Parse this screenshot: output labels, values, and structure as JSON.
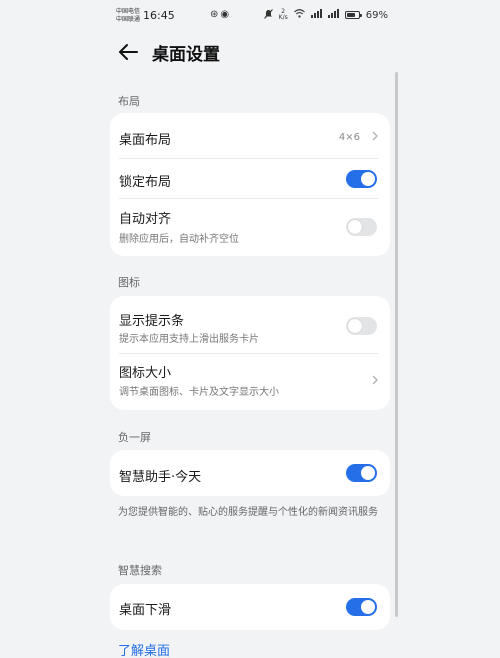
{
  "status_bar": {
    "carrier_1": "中国电信",
    "carrier_2": "中国联通",
    "time": "16:45",
    "net_speed_value": "2",
    "net_speed_unit": "K/s",
    "battery_percent": "69%",
    "battery_level": 0.69
  },
  "header": {
    "title": "桌面设置"
  },
  "sections": {
    "layout": {
      "header": "布局",
      "desktop_layout": {
        "title": "桌面布局",
        "value": "4×6"
      },
      "lock_layout": {
        "title": "锁定布局",
        "enabled": true
      },
      "auto_align": {
        "title": "自动对齐",
        "subtitle": "删除应用后，自动补齐空位",
        "enabled": false
      }
    },
    "icons": {
      "header": "图标",
      "show_badge": {
        "title": "显示提示条",
        "subtitle": "提示本应用支持上滑出服务卡片",
        "enabled": false
      },
      "icon_size": {
        "title": "图标大小",
        "subtitle": "调节桌面图标、卡片及文字显示大小"
      }
    },
    "minus_one": {
      "header": "负一屏",
      "assistant_today": {
        "title": "智慧助手·今天",
        "enabled": true
      },
      "description": "为您提供智能的、贴心的服务提醒与个性化的新闻资讯服务"
    },
    "smart_search": {
      "header": "智慧搜索",
      "swipe_down": {
        "title": "桌面下滑",
        "enabled": true
      }
    }
  },
  "footer_link": "了解桌面",
  "colors": {
    "accent": "#256fe8",
    "background": "#f1f3f5",
    "card": "#ffffff"
  }
}
